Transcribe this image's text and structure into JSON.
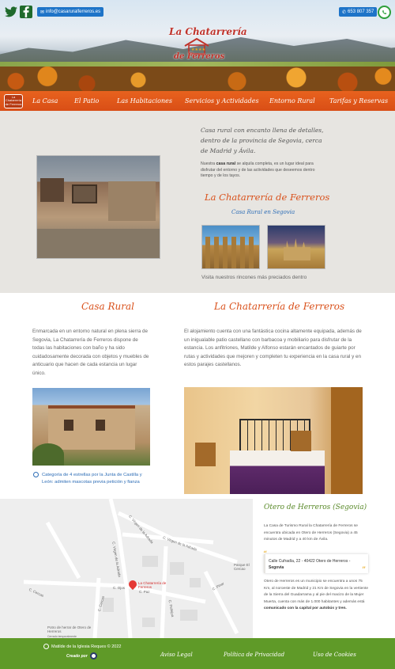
{
  "header": {
    "email": "info@casaruralferreros.es",
    "phone": "653 807 357",
    "logo": {
      "line1": "La Chatarrería",
      "line2": "de Ferreros"
    }
  },
  "nav": {
    "logo_text": "La Chatarrería de Ferreros",
    "items": [
      "La Casa",
      "El Patio",
      "Las Habitaciones",
      "Servicios y Actividades",
      "Entorno Rural",
      "Tarifas y Reservas"
    ]
  },
  "intro": {
    "headline": "Casa rural con encanto llena de detalles, dentro de la provincia de Segovia, cerca de Madrid y Ávila.",
    "text_before": "Nuestra ",
    "text_bold": "casa rural",
    "text_after": " se alquila completa, es un lugar ideal para disfrutar del entorno y de las actividades que deseemos dentro tiempo y de los tayos.",
    "title": "La Chatarrería de Ferreros",
    "subtitle": "Casa Rural en Segovia",
    "caption": "Visita nuestros rincones más preciados dentro"
  },
  "casa": {
    "title": "Casa Rural",
    "text": "Enmarcada en un entorno natural en plena sierra de Segovia, La Chatarrería de Ferreros dispone de todas las habitaciones con baño y ha sido cuidadosamente decorada con objetos y muebles de anticuario que hacen de cada estancia un lugar único.",
    "category": "Categoría de 4 estrellas por la Junta de Castilla y León: admiten mascotas previa petición y fianza"
  },
  "chatarreria": {
    "title": "La Chatarrería de Ferreros",
    "text": "El alojamiento cuenta con una fantástica cocina altamente equipada, además de un inigualable patio castellano con barbacoa y mobiliario para disfrutar de la estancia. Los anfitriones, Matilde y Alfonso estarán encantados de guiarte por rutas y actividades que mejoren y completen tu experiencia en la casa rural y en estos parajes castellanos."
  },
  "map": {
    "labels": [
      "C. Virgen de la Adrada",
      "C. Virgen de la Adrada",
      "C. Virgen de la Adrada",
      "C. Ojos",
      "C. Cercas",
      "C. Cercas",
      "C. Paz",
      "C. Pinar",
      "C. Pellejoa",
      "Parque El Cercao",
      "Potro de herrar de Otero de Herreros",
      "Cerrado temporalmente"
    ],
    "pin_label": "La Chatarrería de Ferreros"
  },
  "location": {
    "title": "Otero de Herreros (Segovia)",
    "p1": "La Casa de Turismo Rural la Chatarrería de Ferreros se encuentra ubicada en Otero de Herreros (Segovia) a 45 minutos de Madrid y a 40 km de Ávila.",
    "address_line1": "Calle Cufradía, 22 - 40422 Otero de Herreros -",
    "address_line2": "Segovia",
    "p2_before": "Otero de Herreros es un municipio se encuentra a unos 75 Km, al noroeste de Madrid y 21 Km de Segovia en la vertiente de la Sierra del Guadarrama y al pie del macizo de la Mujer Muerta, cuenta con más de 1.000 habitantes y además está ",
    "p2_bold": "comunicado con la capital por autobús y tren."
  },
  "footer": {
    "copyright": "Matilde de la Iglesia Reques © 2022",
    "created_by": "Creado por",
    "links": [
      "Aviso Legal",
      "Política de Privacidad",
      "Uso de Cookies"
    ]
  },
  "colors": {
    "accent": "#d9501a",
    "nav": "#e8621e",
    "footer": "#5f9a28",
    "link_blue": "#2d6db6",
    "button_blue": "#1e74c8"
  }
}
